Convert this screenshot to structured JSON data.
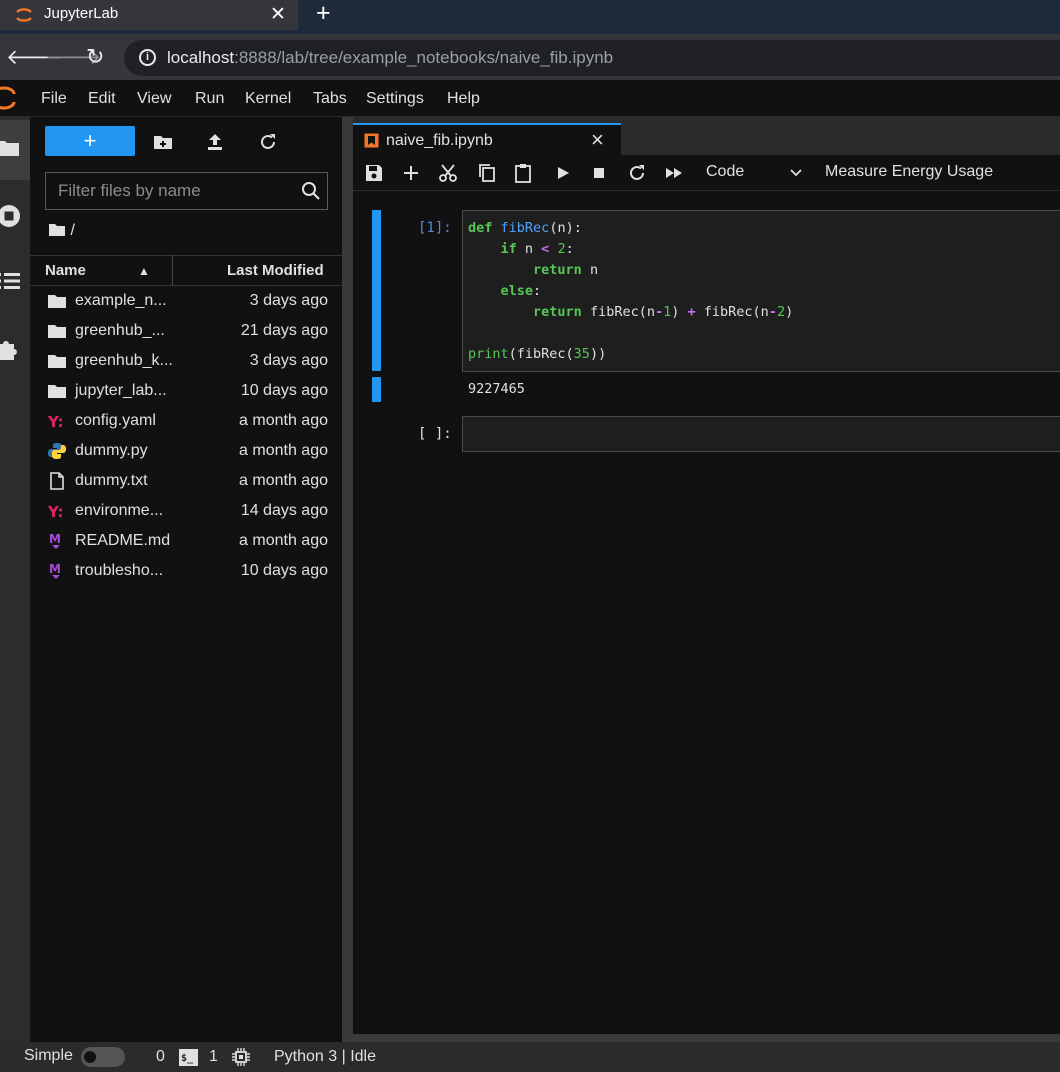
{
  "browser": {
    "tab_title": "JupyterLab",
    "close_glyph": "✕",
    "new_tab_glyph": "+",
    "url_host": "localhost",
    "url_rest": ":8888/lab/tree/example_notebooks/naive_fib.ipynb"
  },
  "menu": [
    "File",
    "Edit",
    "View",
    "Run",
    "Kernel",
    "Tabs",
    "Settings",
    "Help"
  ],
  "filebrowser": {
    "new_label": "+",
    "filter_placeholder": "Filter files by name",
    "breadcrumb": "/",
    "col_name": "Name",
    "col_modified": "Last Modified",
    "files": [
      {
        "name": "example_n...",
        "modified": "3 days ago",
        "icon": "folder-icon"
      },
      {
        "name": "greenhub_...",
        "modified": "21 days ago",
        "icon": "folder-icon"
      },
      {
        "name": "greenhub_k...",
        "modified": "3 days ago",
        "icon": "folder-icon"
      },
      {
        "name": "jupyter_lab...",
        "modified": "10 days ago",
        "icon": "folder-icon"
      },
      {
        "name": "config.yaml",
        "modified": "a month ago",
        "icon": "yaml-icon"
      },
      {
        "name": "dummy.py",
        "modified": "a month ago",
        "icon": "python-icon"
      },
      {
        "name": "dummy.txt",
        "modified": "a month ago",
        "icon": "text-file-icon"
      },
      {
        "name": "environme...",
        "modified": "14 days ago",
        "icon": "yaml-icon"
      },
      {
        "name": "README.md",
        "modified": "a month ago",
        "icon": "markdown-icon"
      },
      {
        "name": "troublesho...",
        "modified": "10 days ago",
        "icon": "markdown-icon"
      }
    ]
  },
  "notebook": {
    "tab_title": "naive_fib.ipynb",
    "cell_type": "Code",
    "energy_button": "Measure Energy Usage",
    "cell1_prompt": "[1]:",
    "cell2_prompt": "[ ]:",
    "output": "9227465"
  },
  "status": {
    "mode": "Simple",
    "terminals": "0",
    "kernels": "1",
    "kernel_status": "Python 3 | Idle"
  },
  "colors": {
    "accent": "#2196f3",
    "jupyter_orange": "#f37726",
    "yaml_red": "#e0245e",
    "markdown_purple": "#7b2fb5"
  }
}
